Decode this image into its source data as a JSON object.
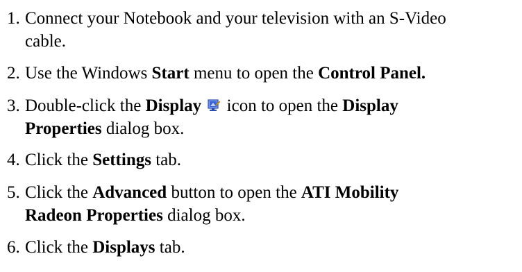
{
  "steps": [
    {
      "num": "1.",
      "line1": "Connect your Notebook and your television with an S-Video",
      "line2": "cable."
    },
    {
      "num": "2.",
      "text_a": "Use the Windows ",
      "bold_a": "Start",
      "text_b": " menu to open the ",
      "bold_b": "Control Panel."
    },
    {
      "num": "3.",
      "text_a": "Double-click the ",
      "bold_a": "Display",
      "icon": "display-properties-icon",
      "text_b": " icon to open the ",
      "bold_b": "Display",
      "line2_bold": "Properties",
      "line2_text": " dialog box."
    },
    {
      "num": "4.",
      "text_a": "Click the ",
      "bold_a": "Settings",
      "text_b": " tab."
    },
    {
      "num": "5.",
      "text_a": "Click the ",
      "bold_a": "Advanced",
      "text_b": " button to open the ",
      "bold_b": "ATI Mobility",
      "line2_bold": "Radeon Properties",
      "line2_text": " dialog box."
    },
    {
      "num": "6.",
      "text_a": "Click the ",
      "bold_a": "Displays",
      "text_b": " tab."
    }
  ],
  "colors": {
    "text": "#000000",
    "background": "#ffffff",
    "icon_blue": "#3a62d8"
  }
}
